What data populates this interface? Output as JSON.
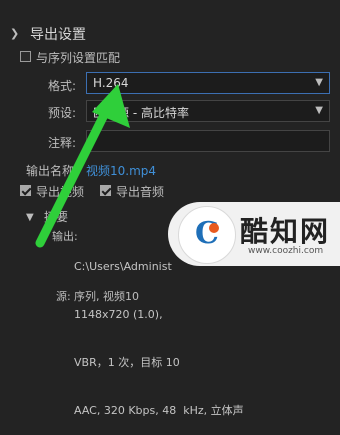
{
  "export_settings": {
    "title": "导出设置",
    "match_sequence_label": "与序列设置匹配",
    "format_label": "格式:",
    "format_value": "H.264",
    "preset_label": "预设:",
    "preset_value": "匹配源 - 高比特率",
    "comment_label": "注释:",
    "output_name_label": "输出名称:",
    "output_name_value": "视频10.mp4",
    "export_video_label": "导出视频",
    "export_audio_label": "导出音频",
    "summary_title": "摘要",
    "summary_output_label": "输出:",
    "summary_lines": [
      "C:\\Users\\Administ",
      "1148x720 (1.0),",
      "VBR，1 次，目标 10",
      "AAC, 320 Kbps, 48  kHz, 立体声"
    ],
    "summary_source_label": "源:",
    "summary_source_value": "序列, 视频10"
  },
  "watermark": {
    "brand_text": "酷知网",
    "url": "www.coozhi.com",
    "logo_letter": "C"
  },
  "colors": {
    "background": "#232323",
    "arrow": "#2fcf3a",
    "link": "#3f8fd7",
    "focus_border": "#3c6fb2"
  }
}
